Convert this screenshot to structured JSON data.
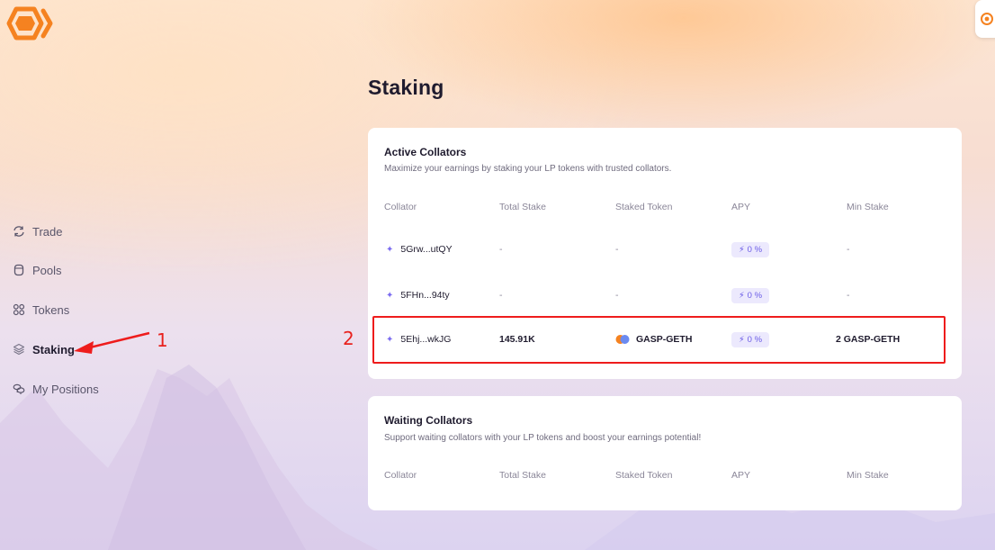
{
  "nav": {
    "items": [
      {
        "label": "Trade",
        "icon": "refresh-arrows-icon"
      },
      {
        "label": "Pools",
        "icon": "cylinder-icon"
      },
      {
        "label": "Tokens",
        "icon": "grid-circles-icon"
      },
      {
        "label": "Staking",
        "icon": "layers-icon",
        "active": true
      },
      {
        "label": "My Positions",
        "icon": "coins-stack-icon"
      }
    ]
  },
  "page": {
    "title": "Staking"
  },
  "active_collators": {
    "title": "Active Collators",
    "subtitle": "Maximize your earnings by staking your LP tokens with trusted collators.",
    "columns": [
      "Collator",
      "Total Stake",
      "Staked Token",
      "APY",
      "Min Stake"
    ],
    "rows": [
      {
        "collator": "5Grw...utQY",
        "total_stake": "-",
        "staked_token": "-",
        "apy": "0 %",
        "min_stake": "-"
      },
      {
        "collator": "5FHn...94ty",
        "total_stake": "-",
        "staked_token": "-",
        "apy": "0 %",
        "min_stake": "-"
      },
      {
        "collator": "5Ehj...wkJG",
        "total_stake": "145.91K",
        "staked_token": "GASP-GETH",
        "apy": "0 %",
        "min_stake": "2 GASP-GETH"
      }
    ]
  },
  "waiting_collators": {
    "title": "Waiting Collators",
    "subtitle": "Support waiting collators with your LP tokens and boost your earnings potential!",
    "columns": [
      "Collator",
      "Total Stake",
      "Staked Token",
      "APY",
      "Min Stake"
    ]
  },
  "annotations": {
    "label_1": "1",
    "label_2": "2"
  },
  "colors": {
    "accent": "#f58220",
    "apy": "#6b5ce7",
    "highlight": "#ee1c1c"
  }
}
